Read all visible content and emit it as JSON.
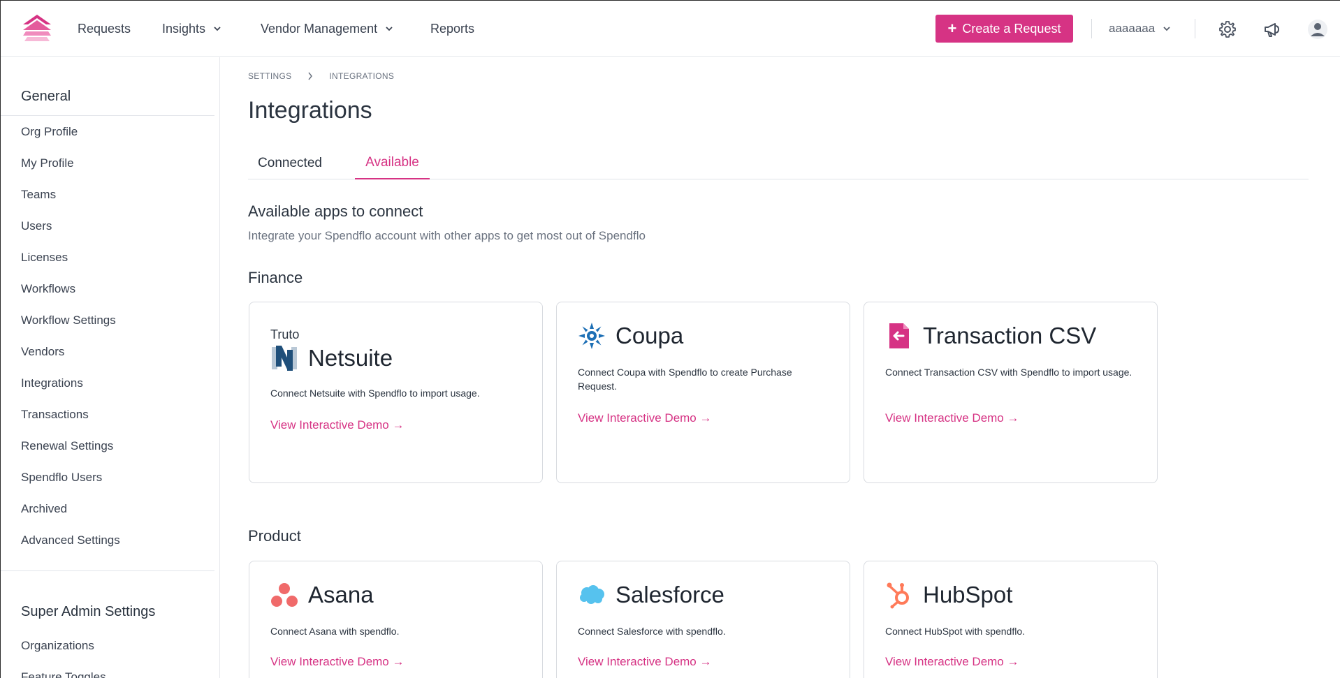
{
  "header": {
    "nav": [
      {
        "label": "Requests",
        "dropdown": false
      },
      {
        "label": "Insights",
        "dropdown": true
      },
      {
        "label": "Vendor Management",
        "dropdown": true
      },
      {
        "label": "Reports",
        "dropdown": false
      }
    ],
    "create_label": "Create a Request",
    "org_name": "aaaaaaa",
    "brand_color": "#d63384"
  },
  "sidebar": {
    "general_title": "General",
    "items": [
      "Org Profile",
      "My Profile",
      "Teams",
      "Users",
      "Licenses",
      "Workflows",
      "Workflow Settings",
      "Vendors",
      "Integrations",
      "Transactions",
      "Renewal Settings",
      "Spendflo Users",
      "Archived",
      "Advanced Settings"
    ],
    "super_title": "Super Admin Settings",
    "super_items": [
      "Organizations",
      "Feature Toggles"
    ]
  },
  "breadcrumb": {
    "root": "SETTINGS",
    "current": "INTEGRATIONS"
  },
  "page_title": "Integrations",
  "tabs": [
    {
      "label": "Connected",
      "active": false
    },
    {
      "label": "Available",
      "active": true
    }
  ],
  "intro": {
    "title": "Available apps to connect",
    "subtitle": "Integrate your Spendflo account with other apps to get most out of Spendflo"
  },
  "finance": {
    "title": "Finance",
    "cards": [
      {
        "prefix": "Truto",
        "name": "Netsuite",
        "icon": "netsuite-logo",
        "desc": "Connect Netsuite with Spendflo to import usage.",
        "link": "View Interactive Demo →"
      },
      {
        "prefix": "",
        "name": "Coupa",
        "icon": "coupa-logo",
        "desc": "Connect Coupa with Spendflo to create Purchase Request.",
        "link": "View Interactive Demo →"
      },
      {
        "prefix": "",
        "name": "Transaction CSV",
        "icon": "transaction-csv-logo",
        "desc": "Connect Transaction CSV with Spendflo to import usage.",
        "link": "View Interactive Demo →"
      }
    ]
  },
  "product": {
    "title": "Product",
    "cards": [
      {
        "name": "Asana",
        "icon": "asana-logo",
        "desc": "Connect Asana with spendflo.",
        "link": "View Interactive Demo →"
      },
      {
        "name": "Salesforce",
        "icon": "salesforce-logo",
        "desc": "Connect Salesforce with spendflo.",
        "link": "View Interactive Demo →"
      },
      {
        "name": "HubSpot",
        "icon": "hubspot-logo",
        "desc": "Connect HubSpot with spendflo.",
        "link": "View Interactive Demo →"
      }
    ]
  }
}
